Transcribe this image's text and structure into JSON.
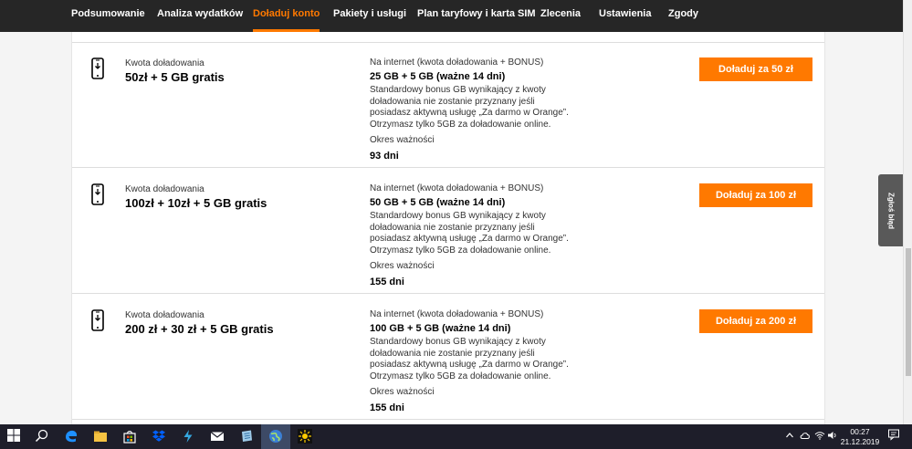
{
  "nav": {
    "items": [
      {
        "label": "Podsumowanie"
      },
      {
        "label": "Analiza wydatków"
      },
      {
        "label": "Doładuj konto",
        "active": true
      },
      {
        "label": "Pakiety i usługi"
      },
      {
        "label": "Plan taryfowy i karta SIM"
      },
      {
        "label": "Zlecenia"
      },
      {
        "label": "Ustawienia"
      },
      {
        "label": "Zgody"
      }
    ]
  },
  "offers": [
    {
      "amount_label": "Kwota doładowania",
      "amount_value": "50zł + 5 GB gratis",
      "internet_label": "Na internet (kwota doładowania + BONUS)",
      "internet_value": "25 GB + 5 GB (ważne 14 dni)",
      "bonus_text": "Standardowy bonus GB wynikający z kwoty doładowania nie zostanie przyznany jeśli posiadasz aktywną usługę „Za darmo w Orange”. Otrzymasz tylko 5GB za doładowanie online.",
      "validity_label": "Okres ważności",
      "validity_value": "93 dni",
      "button_label": "Doładuj za 50 zł"
    },
    {
      "amount_label": "Kwota doładowania",
      "amount_value": "100zł + 10zł + 5 GB gratis",
      "internet_label": "Na internet (kwota doładowania + BONUS)",
      "internet_value": "50 GB + 5 GB (ważne 14 dni)",
      "bonus_text": "Standardowy bonus GB wynikający z kwoty doładowania nie zostanie przyznany jeśli posiadasz aktywną usługę „Za darmo w Orange”. Otrzymasz tylko 5GB za doładowanie online.",
      "validity_label": "Okres ważności",
      "validity_value": "155 dni",
      "button_label": "Doładuj za 100 zł"
    },
    {
      "amount_label": "Kwota doładowania",
      "amount_value": "200 zł + 30 zł + 5 GB gratis",
      "internet_label": "Na internet (kwota doładowania + BONUS)",
      "internet_value": "100 GB + 5 GB (ważne 14 dni)",
      "bonus_text": "Standardowy bonus GB wynikający z kwoty doładowania nie zostanie przyznany jeśli posiadasz aktywną usługę „Za darmo w Orange”. Otrzymasz tylko 5GB za doładowanie online.",
      "validity_label": "Okres ważności",
      "validity_value": "155 dni",
      "button_label": "Doładuj za 200 zł"
    }
  ],
  "report_tab": {
    "label": "Zgłoś błąd"
  },
  "taskbar": {
    "time": "00:27",
    "date": "21.12.2019",
    "icons": [
      "windows-start-icon",
      "search-icon",
      "edge-icon",
      "file-explorer-icon",
      "store-icon",
      "dropbox-icon",
      "app-icon",
      "mail-icon",
      "notes-icon",
      "browser-icon",
      "app-icon"
    ]
  },
  "colors": {
    "accent": "#ff7900",
    "nav_bg": "#262626",
    "taskbar_bg": "#1e1e2a"
  }
}
